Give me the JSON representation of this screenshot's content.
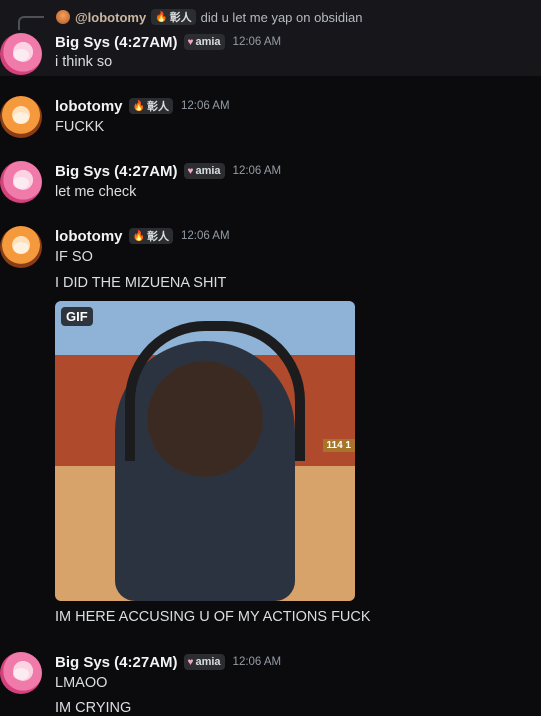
{
  "reply": {
    "author": "@lobotomy",
    "tag": "彰人",
    "text": "did u let me yap on obsidian"
  },
  "messages": [
    {
      "author": "Big Sys (4:27AM)",
      "tag": "amia",
      "time": "12:06 AM",
      "lines": [
        "i think so"
      ]
    },
    {
      "author": "lobotomy",
      "tag": "彰人",
      "time": "12:06 AM",
      "lines": [
        "FUCKK"
      ]
    },
    {
      "author": "Big Sys (4:27AM)",
      "tag": "amia",
      "time": "12:06 AM",
      "lines": [
        "let me check"
      ]
    },
    {
      "author": "lobotomy",
      "tag": "彰人",
      "time": "12:06 AM",
      "lines": [
        "IF SO",
        "I DID THE MIZUENA SHIT",
        "IM HERE ACCUSING U OF MY ACTIONS FUCK"
      ]
    },
    {
      "author": "Big Sys (4:27AM)",
      "tag": "amia",
      "time": "12:06 AM",
      "lines": [
        "LMAOO",
        "IM CRYING"
      ]
    }
  ],
  "gif": {
    "badge": "GIF",
    "overlay": "114 1"
  }
}
